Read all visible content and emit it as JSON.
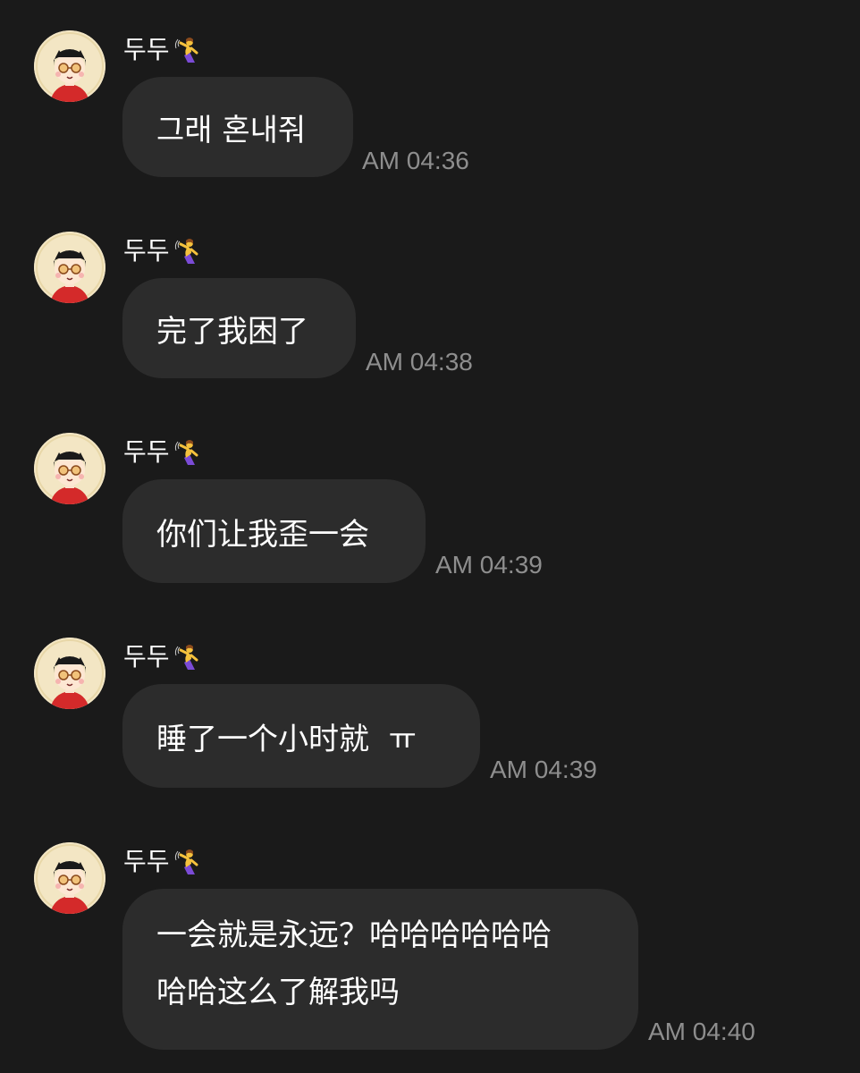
{
  "messages": [
    {
      "sender": "두두",
      "avatar_icon": "cartoon-girl-avatar-icon",
      "sender_emoji": "dancing-woman-emoji-icon",
      "lines": [
        "그래 혼내줘"
      ],
      "time": "AM 04:36"
    },
    {
      "sender": "두두",
      "avatar_icon": "cartoon-girl-avatar-icon",
      "sender_emoji": "dancing-woman-emoji-icon",
      "lines": [
        "完了我困了"
      ],
      "time": "AM 04:38"
    },
    {
      "sender": "두두",
      "avatar_icon": "cartoon-girl-avatar-icon",
      "sender_emoji": "dancing-woman-emoji-icon",
      "lines": [
        "你们让我歪一会"
      ],
      "time": "AM 04:39"
    },
    {
      "sender": "두두",
      "avatar_icon": "cartoon-girl-avatar-icon",
      "sender_emoji": "dancing-woman-emoji-icon",
      "lines": [
        "睡了一个小时就  ㅠ"
      ],
      "time": "AM 04:39"
    },
    {
      "sender": "두두",
      "avatar_icon": "cartoon-girl-avatar-icon",
      "sender_emoji": "dancing-woman-emoji-icon",
      "lines": [
        "一会就是永远？哈哈哈哈哈哈",
        "哈哈这么了解我吗"
      ],
      "time": "AM 04:40"
    }
  ],
  "colors": {
    "background": "#1a1a1a",
    "bubble": "#2c2c2c",
    "text": "#ffffff",
    "time": "#8e8e8e"
  }
}
